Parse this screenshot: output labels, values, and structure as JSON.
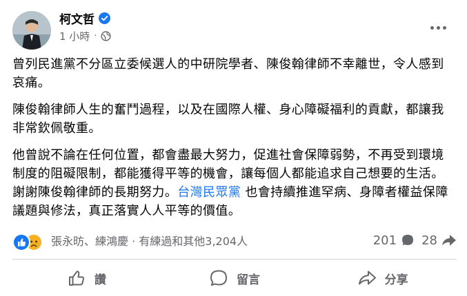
{
  "author": {
    "name": "柯文哲",
    "time": "1 小時",
    "separator": "·"
  },
  "icons": {
    "verified": "verified-badge-icon",
    "privacy": "globe-icon",
    "more": "more-options-icon",
    "like_reaction": "like-reaction-icon",
    "sad_reaction": "sad-reaction-icon",
    "comment": "comment-icon",
    "share": "share-icon"
  },
  "colors": {
    "link": "#1877f2",
    "like": "#1877f2",
    "sad": "#f7b125",
    "muted": "#65676b"
  },
  "post": {
    "p1": "曾列民進黨不分區立委候選人的中研院學者、陳俊翰律師不幸離世，令人感到哀痛。",
    "p2": "陳俊翰律師人生的奮鬥過程，以及在國際人權、身心障礙福利的貢獻，都讓我非常欽佩敬重。",
    "p3_before": "他曾說不論在任何位置，都會盡最大努力，促進社會保障弱勢，不再受到環境制度的阻礙限制，都能獲得平等的機會，讓每個人都能追求自己想要的生活。謝謝陳俊翰律師的長期努力。",
    "p3_link": "台灣民眾黨",
    "p3_after": " 也會持續推進罕病、身障者權益保障議題與修法，真正落實人人平等的價值。"
  },
  "stats": {
    "reactors": "張永昉、練鴻慶 · 有練過和其他3,204人",
    "comments": "201",
    "shares": "28"
  },
  "actions": {
    "like": "讚",
    "comment": "留言",
    "share": "分享"
  }
}
